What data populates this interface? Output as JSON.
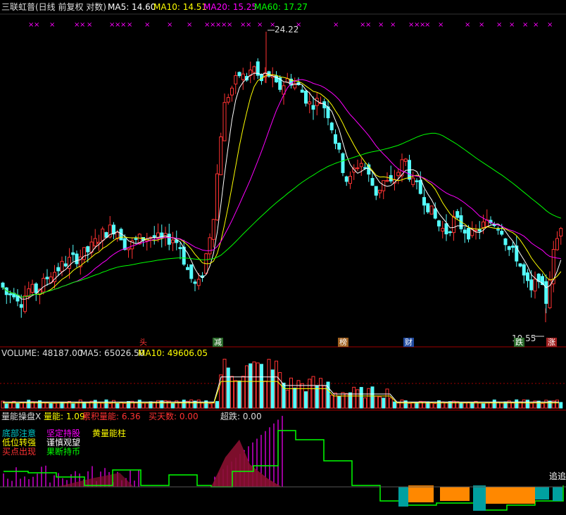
{
  "header": {
    "stock_title": "三联虹普(日线 前复权 对数)",
    "ma5_label": "MA5: 14.60",
    "ma10_label": "MA10: 14.51",
    "ma20_label": "MA20: 15.25",
    "ma60_label": "MA60: 17.27"
  },
  "price_panel": {
    "high_label": "24.22",
    "low_label": "10.55",
    "markers": [
      "头",
      "减",
      "榜",
      "财",
      "跌",
      "涨"
    ]
  },
  "volume_panel": {
    "vol_label": "VOLUME: 48187.00",
    "ma5_label": "MA5: 65026.50",
    "ma10_label": "MA10: 49606.05"
  },
  "indicator_panel": {
    "title": "量能操盘X",
    "energy_label": "量能: 1.09",
    "accum_label": "累积量能: 6.36",
    "buy_label": "买天数: 0.00",
    "overfall_label": "超跌: 0.00",
    "legend": {
      "bottom_attention": "底部注意",
      "hold_firmly": "坚定持股",
      "yellow_energy": "黄量能柱",
      "low_turn_strong": "低位转强",
      "cautious_watch": "谨慎观望",
      "buy_point": "买点出现",
      "decisive_sell": "果断持币"
    },
    "chase_label": "追追"
  },
  "colors": {
    "up": "#ff3232",
    "down": "#54fcfc",
    "ma5": "#ffffff",
    "ma10": "#ffff00",
    "ma20": "#ff00ff",
    "ma60": "#00ff00",
    "grid": "#a00000"
  },
  "chart_data": {
    "type": "candlestick",
    "high": 24.22,
    "low": 10.55,
    "ma5": 14.6,
    "ma10": 14.51,
    "ma20": 15.25,
    "ma60": 17.27,
    "volume": 48187.0,
    "volume_ma5": 65026.5,
    "volume_ma10": 49606.05,
    "energy": 1.09,
    "accumulated_energy": 6.36,
    "buy_days": 0.0,
    "overfall": 0.0
  }
}
